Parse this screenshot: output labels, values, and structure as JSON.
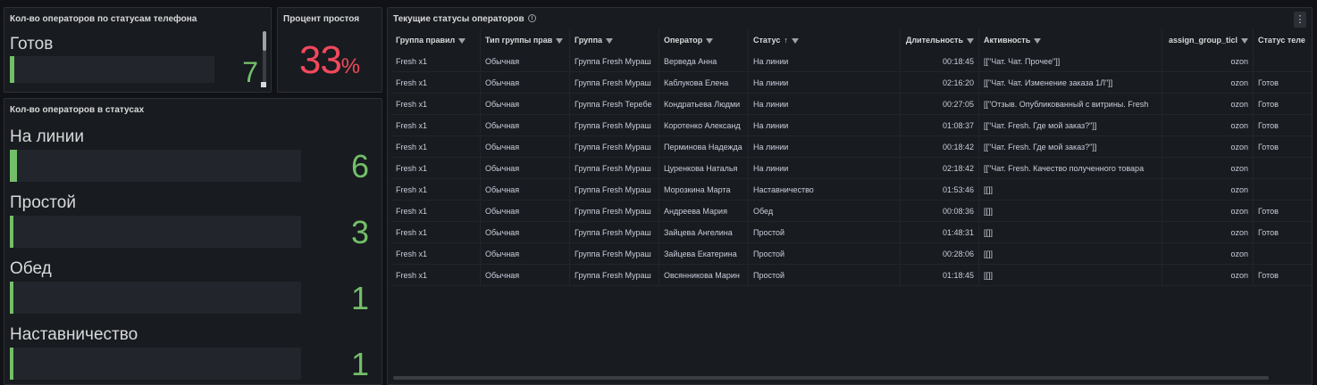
{
  "phone_panel": {
    "title": "Кол-во операторов по статусам телефона",
    "items": [
      {
        "label": "Готов",
        "value": "7",
        "fill": 0.02
      }
    ]
  },
  "idle_panel": {
    "title": "Процент простоя",
    "value": "33",
    "unit": "%"
  },
  "status_panel": {
    "title": "Кол-во операторов в статусах",
    "items": [
      {
        "label": "На линии",
        "value": "6",
        "fill": 0.025
      },
      {
        "label": "Простой",
        "value": "3",
        "fill": 0.013
      },
      {
        "label": "Обед",
        "value": "1",
        "fill": 0.005
      },
      {
        "label": "Наставничество",
        "value": "1",
        "fill": 0.005
      }
    ]
  },
  "table_panel": {
    "title": "Текущие статусы операторов",
    "info_icon": "info-icon",
    "menu_icon": "⋮",
    "columns": [
      {
        "label": "Группа правил",
        "filter": true
      },
      {
        "label": "Тип группы прав",
        "filter": true
      },
      {
        "label": "Группа",
        "filter": true
      },
      {
        "label": "Оператор",
        "filter": true
      },
      {
        "label": "Статус",
        "filter": true,
        "sort": "↑"
      },
      {
        "label": "Длительность",
        "filter": true
      },
      {
        "label": "Активность",
        "filter": true
      },
      {
        "label": "assign_group_ticl",
        "filter": true
      },
      {
        "label": "Статус теле",
        "filter": false
      }
    ],
    "rows": [
      [
        "Fresh x1",
        "Обычная",
        "Группа Fresh Мураш",
        "Верведа Анна",
        "На линии",
        "00:18:45",
        "[[\"Чат. Чат. Прочее\"]]",
        "ozon",
        ""
      ],
      [
        "Fresh x1",
        "Обычная",
        "Группа Fresh Мураш",
        "Каблукова Елена",
        "На линии",
        "02:16:20",
        "[[\"Чат. Чат. Изменение заказа 1Л\"]]",
        "ozon",
        "Готов"
      ],
      [
        "Fresh x1",
        "Обычная",
        "Группа Fresh Теребе",
        "Кондратьева Людми",
        "На линии",
        "00:27:05",
        "[[\"Отзыв. Опубликованный с витрины. Fresh",
        "ozon",
        "Готов"
      ],
      [
        "Fresh x1",
        "Обычная",
        "Группа Fresh Мураш",
        "Коротенко Александ",
        "На линии",
        "01:08:37",
        "[[\"Чат. Fresh. Где мой заказ?\"]]",
        "ozon",
        "Готов"
      ],
      [
        "Fresh x1",
        "Обычная",
        "Группа Fresh Мураш",
        "Перминова Надежда",
        "На линии",
        "00:18:42",
        "[[\"Чат. Fresh. Где мой заказ?\"]]",
        "ozon",
        "Готов"
      ],
      [
        "Fresh x1",
        "Обычная",
        "Группа Fresh Мураш",
        "Цуренкова Наталья",
        "На линии",
        "02:18:42",
        "[[\"Чат. Fresh. Качество полученного товара",
        "ozon",
        ""
      ],
      [
        "Fresh x1",
        "Обычная",
        "Группа Fresh Мураш",
        "Морозкина Марта",
        "Наставничество",
        "01:53:46",
        "[[]]",
        "ozon",
        ""
      ],
      [
        "Fresh x1",
        "Обычная",
        "Группа Fresh Мураш",
        "Андреева Мария",
        "Обед",
        "00:08:36",
        "[[]]",
        "ozon",
        "Готов"
      ],
      [
        "Fresh x1",
        "Обычная",
        "Группа Fresh Мураш",
        "Зайцева Ангелина",
        "Простой",
        "01:48:31",
        "[[]]",
        "ozon",
        "Готов"
      ],
      [
        "Fresh x1",
        "Обычная",
        "Группа Fresh Мураш",
        "Зайцева Екатерина",
        "Простой",
        "00:28:06",
        "[[]]",
        "ozon",
        ""
      ],
      [
        "Fresh x1",
        "Обычная",
        "Группа Fresh Мураш",
        "Овсянникова Марин",
        "Простой",
        "01:18:45",
        "[[]]",
        "ozon",
        "Готов"
      ]
    ]
  },
  "colors": {
    "background": "#111217",
    "panel": "#181b1f",
    "bar_green": "#73bf69",
    "stat_red": "#f2495c"
  }
}
